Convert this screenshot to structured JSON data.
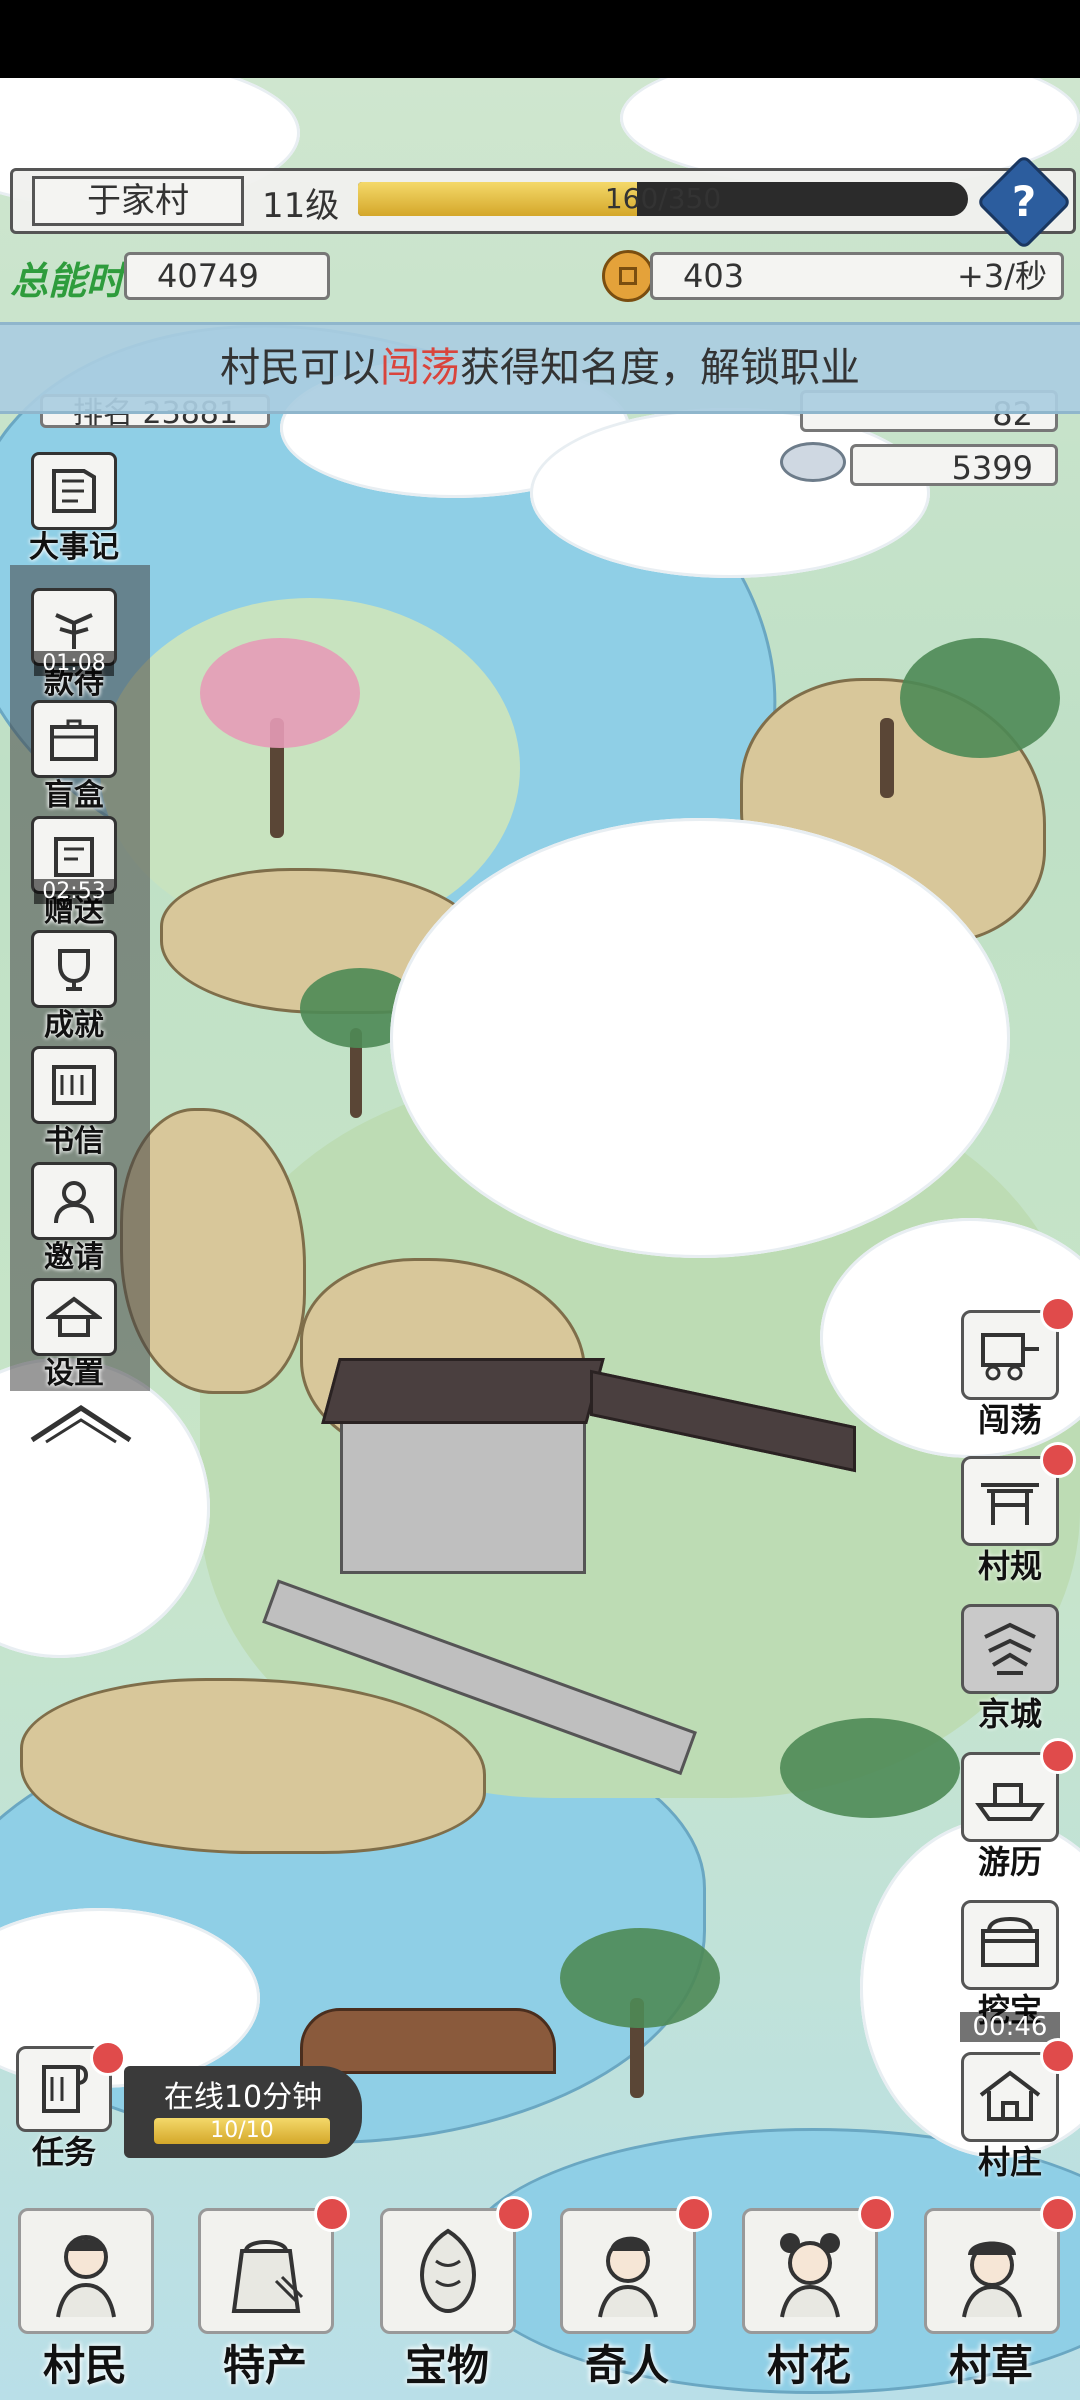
{
  "header": {
    "village_name": "于家村",
    "level": "11级",
    "xp_text": "160/350",
    "xp_progress": 0.457,
    "help_label": "?"
  },
  "stats": {
    "logo_text": "总能时",
    "total": "40749",
    "coins": "403",
    "coin_rate": "+3/秒",
    "rank": "排名 23881",
    "fame": "82",
    "silver": "5399"
  },
  "banner": {
    "prefix": "村民可以",
    "highlight": "闯荡",
    "suffix": "获得知名度，解锁职业"
  },
  "left_menu": [
    {
      "label": "大事记",
      "icon": "book-icon",
      "timer": ""
    },
    {
      "label": "款待",
      "icon": "tree-icon",
      "timer": "01:08"
    },
    {
      "label": "盲盒",
      "icon": "chest-icon",
      "timer": ""
    },
    {
      "label": "赠送",
      "icon": "gift-icon",
      "timer": "02:53"
    },
    {
      "label": "成就",
      "icon": "trophy-icon",
      "timer": ""
    },
    {
      "label": "书信",
      "icon": "letter-icon",
      "timer": ""
    },
    {
      "label": "邀请",
      "icon": "person-icon",
      "timer": ""
    },
    {
      "label": "设置",
      "icon": "hat-icon",
      "timer": ""
    }
  ],
  "right_menu": [
    {
      "label": "闯荡",
      "icon": "carriage-icon",
      "timer": ""
    },
    {
      "label": "村规",
      "icon": "gate-icon",
      "timer": ""
    },
    {
      "label": "京城",
      "icon": "pagoda-icon",
      "timer": ""
    },
    {
      "label": "游历",
      "icon": "boat-icon",
      "timer": ""
    },
    {
      "label": "挖宝",
      "icon": "treasure-chest-icon",
      "timer": "00:46"
    },
    {
      "label": "村庄",
      "icon": "house-icon",
      "timer": ""
    }
  ],
  "task": {
    "label": "任务",
    "online_text": "在线10分钟",
    "online_progress_text": "10/10",
    "online_progress": 1.0
  },
  "bottom_nav": [
    {
      "label": "村民",
      "icon": "villager-icon"
    },
    {
      "label": "特产",
      "icon": "produce-sack-icon"
    },
    {
      "label": "宝物",
      "icon": "treasure-icon"
    },
    {
      "label": "奇人",
      "icon": "stranger-icon"
    },
    {
      "label": "村花",
      "icon": "village-girl-icon"
    },
    {
      "label": "村草",
      "icon": "village-boy-icon"
    }
  ],
  "colors": {
    "accent_gold": "#e2b53a",
    "badge_red": "#e04b4b",
    "highlight_red": "#d9443c",
    "help_blue": "#2c5d9e"
  }
}
